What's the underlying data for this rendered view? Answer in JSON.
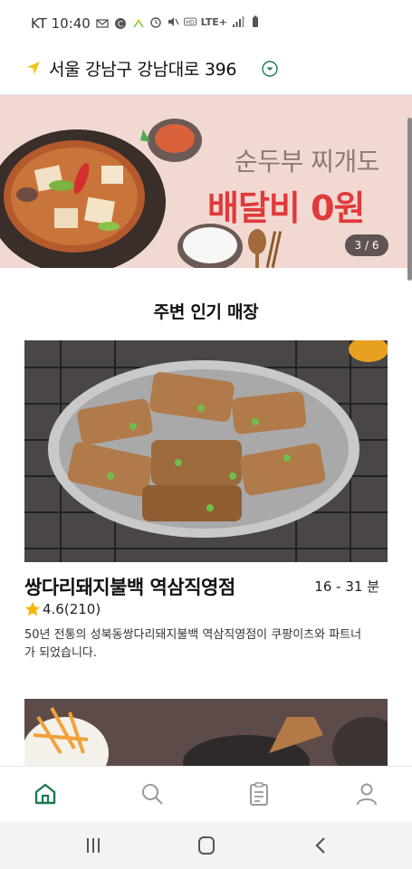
{
  "status_bar": {
    "carrier_time": "KT 10:40",
    "network": "LTE+"
  },
  "address": {
    "text": "서울 강남구 강남대로 396"
  },
  "banner": {
    "line1": "순두부 찌개도",
    "line2": "배달비 0원",
    "pager": "3 / 6"
  },
  "section": {
    "title": "주변 인기 매장"
  },
  "stores": [
    {
      "name": "쌍다리돼지불백 역삼직영점",
      "delivery_time": "16 - 31 분",
      "rating": "4.6",
      "reviews": "(210)",
      "description": "50년 전통의 성북동쌍다리돼지불백 역삼직영점이 쿠팡이츠와 파트너가 되었습니다."
    }
  ],
  "tabbar": {
    "items": [
      "home-icon",
      "search-icon",
      "orders-icon",
      "profile-icon"
    ],
    "active": "home-icon",
    "active_color": "#1b7a4f"
  },
  "colors": {
    "banner_red": "#e03a3a",
    "accent_green": "#1b7a4f",
    "location_yellow": "#f3c318"
  }
}
